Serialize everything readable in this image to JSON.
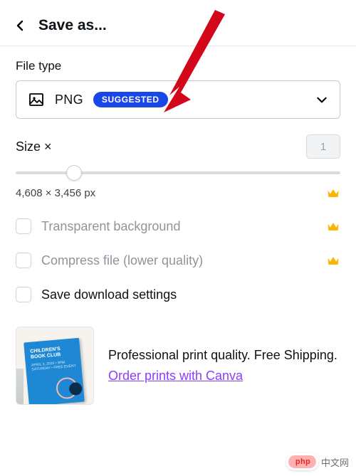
{
  "header": {
    "title": "Save as..."
  },
  "filetype": {
    "section_label": "File type",
    "value": "PNG",
    "badge": "SUGGESTED"
  },
  "size": {
    "label": "Size ×",
    "multiplier": "1",
    "dimensions": "4,608 × 3,456 px",
    "slider_pct": 18
  },
  "options": {
    "transparent": {
      "label": "Transparent background",
      "premium": true,
      "enabled": false
    },
    "compress": {
      "label": "Compress file (lower quality)",
      "premium": true,
      "enabled": false
    },
    "save_settings": {
      "label": "Save download settings",
      "premium": false,
      "enabled": true
    }
  },
  "promo": {
    "line1": "Professional print quality. Free Shipping.",
    "link": "Order prints with Canva",
    "thumb": {
      "title": "CHILDREN'S",
      "title2": "BOOK CLUB",
      "sub": "APRIL 3, 2020 • 3PM SATURDAY • FREE EVENT"
    }
  },
  "watermark": {
    "brand": "php",
    "site": "中文网"
  },
  "colors": {
    "badge_bg": "#1946e6",
    "crown": "#f7b500",
    "link": "#8b3dff",
    "arrow": "#d4071a"
  }
}
